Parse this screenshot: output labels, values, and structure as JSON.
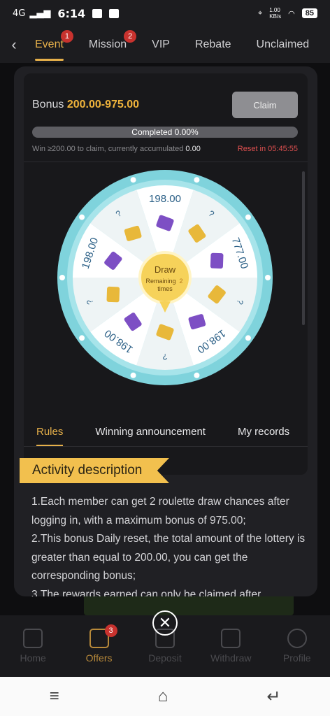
{
  "status": {
    "network": "4G",
    "time": "6:14",
    "speed": "1.00\nKB/s",
    "battery": "85"
  },
  "topnav": {
    "tabs": [
      {
        "label": "Event",
        "badge": "1"
      },
      {
        "label": "Mission",
        "badge": "2"
      },
      {
        "label": "VIP"
      },
      {
        "label": "Rebate"
      },
      {
        "label": "Unclaimed"
      }
    ]
  },
  "modal": {
    "bonus_label": "Bonus",
    "bonus_value": "200.00-975.00",
    "claim_label": "Claim",
    "progress_text": "Completed 0.00%",
    "progress_fraction": 0.0,
    "win_text": "Win ≥200.00 to claim, currently accumulated",
    "accumulated": "0.00",
    "reset_text": "Reset in 05:45:55",
    "wheel": {
      "draw_label": "Draw",
      "remaining_label": "Remaining",
      "remaining_count": "2",
      "times_label": "times",
      "segments": [
        "198.00",
        "?",
        "777.00",
        "?",
        "198.00",
        "?",
        "198.00",
        "?",
        "198.00",
        "?"
      ]
    },
    "tabs": [
      "Rules",
      "Winning announcement",
      "My records"
    ],
    "desc_title": "Activity description",
    "desc_lines": [
      "1.Each member can get 2 roulette draw chances after logging in, with a maximum bonus of 975.00;",
      "2.This bonus Daily reset, the total amount of the lottery is greater than equal to 200.00, you can get the corresponding bonus;",
      "3.The rewards earned can only be claimed after"
    ]
  },
  "bottomnav": [
    {
      "label": "Home"
    },
    {
      "label": "Offers",
      "badge": "3"
    },
    {
      "label": "Deposit"
    },
    {
      "label": "Withdraw"
    },
    {
      "label": "Profile"
    }
  ],
  "colors": {
    "accent": "#e6b04a",
    "wheel_ring": "#7fd3dc",
    "reset": "#e05050"
  }
}
